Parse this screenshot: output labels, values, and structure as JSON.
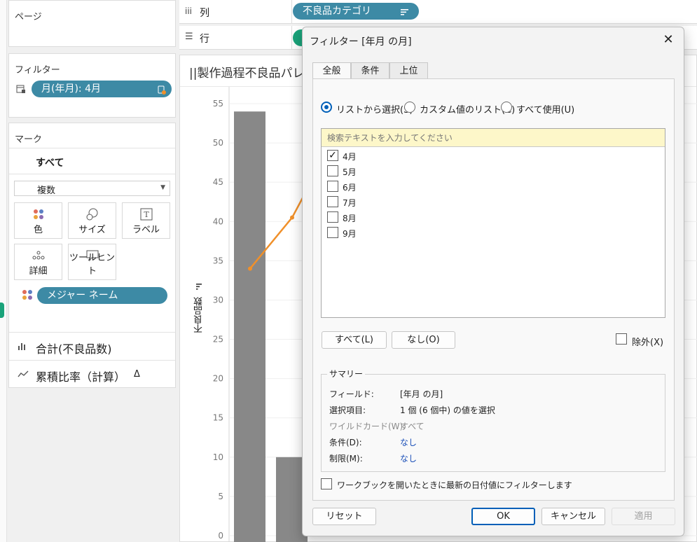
{
  "pages_card": {
    "title": "ページ"
  },
  "shelves": {
    "columns_label": "列",
    "rows_label": "行",
    "columns_pill": "不良品カテゴリ"
  },
  "filters_card": {
    "title": "フィルター",
    "pill": "月(年月): 4月"
  },
  "marks_card": {
    "title": "マーク",
    "all_label": "すべて",
    "type_dropdown": "複数",
    "buttons": {
      "color": "色",
      "size": "サイズ",
      "label": "ラベル",
      "detail": "詳細",
      "tooltip": "ツールヒント"
    },
    "measure_pill": "メジャー ネーム",
    "measures": [
      "合計(不良品数)",
      "累積比率（計算）"
    ],
    "delta_glyph": "Δ"
  },
  "sheet": {
    "title": "||製作過程不良品パレ",
    "ylabel": "不良品数"
  },
  "chart_data": {
    "type": "bar",
    "ylabel": "不良品数",
    "ylim": [
      0,
      55
    ],
    "yticks": [
      0,
      5,
      10,
      15,
      20,
      25,
      30,
      35,
      40,
      45,
      50,
      55
    ],
    "bars_visible": [
      54,
      10
    ],
    "line_points_visible": [
      34,
      40.5,
      43
    ]
  },
  "dialog": {
    "title": "フィルター [年月 の月]",
    "tabs": [
      "全般",
      "条件",
      "上位"
    ],
    "radios": [
      "リストから選択(S)",
      "カスタム値のリスト(C)",
      "すべて使用(U)"
    ],
    "search_placeholder": "検索テキストを入力してください",
    "list": [
      {
        "label": "4月",
        "checked": true
      },
      {
        "label": "5月",
        "checked": false
      },
      {
        "label": "6月",
        "checked": false
      },
      {
        "label": "7月",
        "checked": false
      },
      {
        "label": "8月",
        "checked": false
      },
      {
        "label": "9月",
        "checked": false
      }
    ],
    "all_button": "すべて(L)",
    "none_button": "なし(O)",
    "exclude_label": "除外(X)",
    "summary": {
      "title": "サマリー",
      "rows": [
        {
          "key": "フィールド:",
          "value": "[年月 の月]"
        },
        {
          "key": "選択項目:",
          "value": "1 個 (6 個中) の値を選択"
        },
        {
          "key": "ワイルドカード(W):",
          "value": "すべて"
        },
        {
          "key": "条件(D):",
          "value": "なし"
        },
        {
          "key": "制限(M):",
          "value": "なし"
        }
      ]
    },
    "latest_date_label": "ワークブックを開いたときに最新の日付値にフィルターします",
    "reset_button": "リセット",
    "ok_button": "OK",
    "cancel_button": "キャンセル",
    "apply_button": "適用"
  },
  "colors": {
    "pill_blue": "#3d8aa5",
    "pill_green": "#1aa37a",
    "bar_gray": "#888888",
    "line_orange": "#f0902a",
    "accent": "#005fb8"
  }
}
